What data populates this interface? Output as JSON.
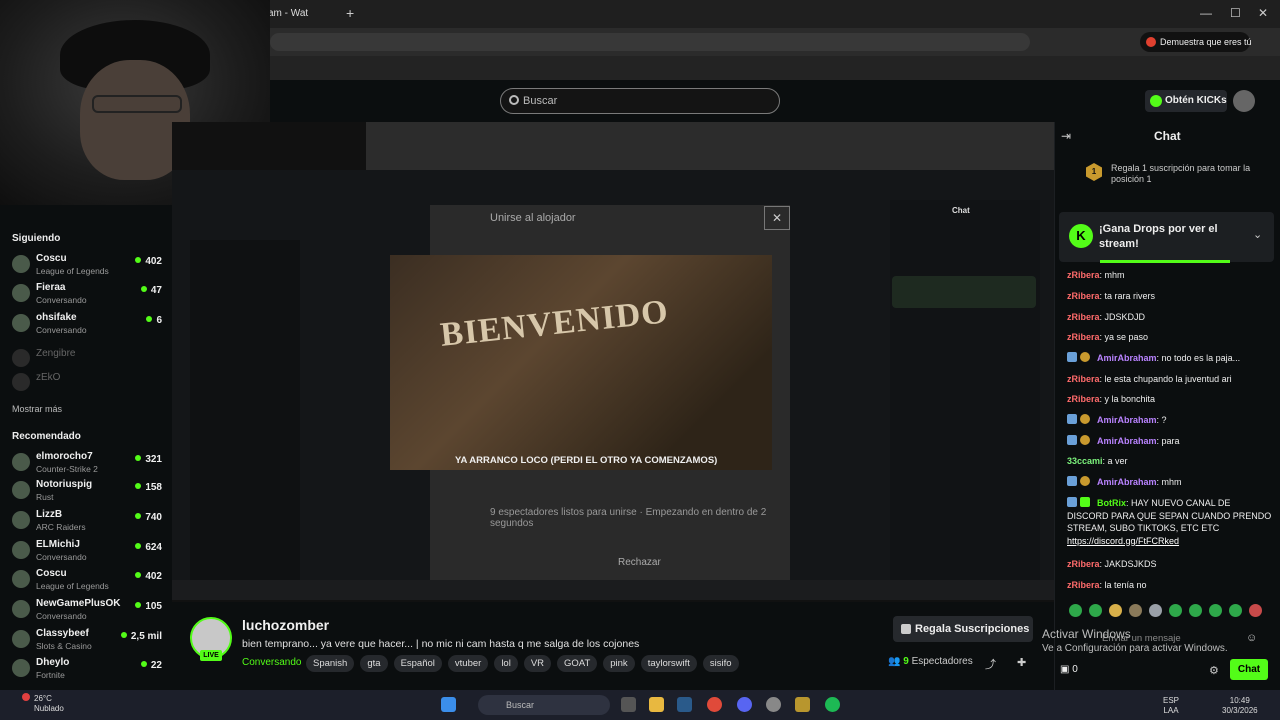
{
  "browser": {
    "tab_title": "am - Wat",
    "new_tab": "+",
    "profile_button": "Demuestra que eres tú",
    "minimize": "—",
    "maximize": "☐",
    "close": "✕"
  },
  "header": {
    "search_placeholder": "Buscar",
    "kicks_button": "Obtén KICKs"
  },
  "sidebar": {
    "following_heading": "Siguiendo",
    "following": [
      {
        "name": "Coscu",
        "sub": "League of Legends",
        "count": "402",
        "live": true
      },
      {
        "name": "Fieraa",
        "sub": "Conversando",
        "count": "47",
        "live": true
      },
      {
        "name": "ohsifake",
        "sub": "Conversando",
        "count": "6",
        "live": true
      },
      {
        "name": "Zengibre",
        "sub": "",
        "count": "",
        "live": false
      },
      {
        "name": "zEkO",
        "sub": "",
        "count": "",
        "live": false
      }
    ],
    "show_more": "Mostrar más",
    "recommended_heading": "Recomendado",
    "recommended": [
      {
        "name": "elmorocho7",
        "sub": "Counter-Strike 2",
        "count": "321"
      },
      {
        "name": "Notoriuspig",
        "sub": "Rust",
        "count": "158"
      },
      {
        "name": "LizzB",
        "sub": "ARC Raiders",
        "count": "740"
      },
      {
        "name": "ELMichiJ",
        "sub": "Conversando",
        "count": "624"
      },
      {
        "name": "Coscu",
        "sub": "League of Legends",
        "count": "402"
      },
      {
        "name": "NewGamePlusOK",
        "sub": "Conversando",
        "count": "105"
      },
      {
        "name": "Classybeef",
        "sub": "Slots & Casino",
        "count": "2,5 mil"
      },
      {
        "name": "Dheylo",
        "sub": "Fortnite",
        "count": "22"
      }
    ]
  },
  "video": {
    "modal_title": "Unirse al alojador",
    "modal_close": "✕",
    "banner_text": "BIENVENIDO",
    "stream_caption": "YA ARRANCO LOCO (PERDI EL OTRO YA COMENZAMOS)",
    "footer_text": "9 espectadores listos para unirse · Empezando en dentro de 2 segundos",
    "reject": "Rechazar",
    "inner_chat_title": "Chat"
  },
  "streamer": {
    "name": "luchozomber",
    "live": "LIVE",
    "title": "bien temprano... ya vere que hacer... | no mic ni cam hasta q me salga de los cojones",
    "category": "Conversando",
    "tags": [
      "Spanish",
      "gta",
      "Español",
      "vtuber",
      "lol",
      "VR",
      "GOAT",
      "pink",
      "taylorswift",
      "sisifo"
    ],
    "gift_button": "Regala Suscripciones",
    "viewers": "9",
    "viewers_label": "Espectadores"
  },
  "chat": {
    "title": "Chat",
    "sub_promo_rank": "1",
    "sub_promo": "Regala 1 suscripción para tomar la posición 1",
    "drops_title": "¡Gana Drops por ver el stream!",
    "messages": [
      {
        "user": "zRibera",
        "type": "z",
        "text": "mhm"
      },
      {
        "user": "zRibera",
        "type": "z",
        "text": "ta rara rivers"
      },
      {
        "user": "zRibera",
        "type": "z",
        "text": "JDSKDJD"
      },
      {
        "user": "zRibera",
        "type": "z",
        "text": "ya se paso"
      },
      {
        "user": "AmirAbraham",
        "type": "a",
        "text": "no todo es la paja..."
      },
      {
        "user": "zRibera",
        "type": "z",
        "text": "le esta chupando la juventud ari"
      },
      {
        "user": "zRibera",
        "type": "z",
        "text": "y la bonchita"
      },
      {
        "user": "AmirAbraham",
        "type": "a",
        "text": "?"
      },
      {
        "user": "AmirAbraham",
        "type": "a",
        "text": "para"
      },
      {
        "user": "33ccami",
        "type": "3",
        "text": "a ver"
      },
      {
        "user": "AmirAbraham",
        "type": "a",
        "text": "mhm"
      },
      {
        "user": "BotRix",
        "type": "b",
        "text": "HAY NUEVO CANAL DE DISCORD PARA QUE SEPAN CUANDO PRENDO STREAM, SUBO TIKTOKS, ETC ETC",
        "link": "https://discord.gg/FtFCRked"
      },
      {
        "user": "zRibera",
        "type": "z",
        "text": "JAKDSJKDS"
      },
      {
        "user": "zRibera",
        "type": "z",
        "text": "la tenía no"
      }
    ],
    "input_placeholder": "Enviar un mensaje",
    "activate_title": "Activar Windows",
    "activate_sub": "Ve a Configuración para activar Windows.",
    "points": "0",
    "send_button": "Chat"
  },
  "taskbar": {
    "weather_temp": "26°C",
    "weather_desc": "Nublado",
    "weather_badge": "2",
    "search": "Buscar",
    "lang": "ESP",
    "lang2": "LAA",
    "time": "10:49",
    "date": "30/3/2026"
  },
  "colors": {
    "kick_green": "#53fc18",
    "bg": "#0b0e0f",
    "chat_user_red": "#ff6b6b",
    "chat_user_purple": "#b983ff"
  }
}
